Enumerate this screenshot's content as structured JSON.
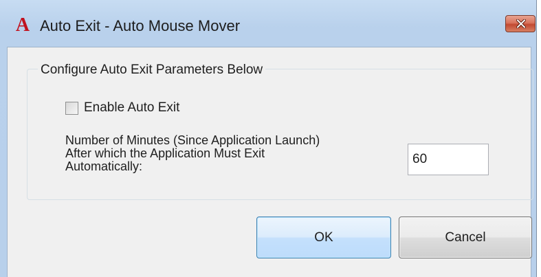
{
  "window": {
    "title": "Auto Exit - Auto Mouse Mover",
    "app_icon_glyph": "A",
    "app_icon_name": "autocad-a-icon",
    "close_icon_name": "close-icon"
  },
  "group": {
    "legend": "Configure Auto Exit Parameters Below"
  },
  "enable_auto_exit": {
    "label": "Enable Auto Exit",
    "checked": false
  },
  "minutes": {
    "description_lines": [
      "Number of Minutes (Since Application Launch)",
      "After which the Application Must Exit",
      "Automatically:"
    ],
    "value": "60"
  },
  "buttons": {
    "ok": "OK",
    "cancel": "Cancel"
  },
  "colors": {
    "title_bar": "#c0d7f0",
    "close_button": "#c9553d",
    "dialog_background": "#f0f0f0",
    "ok_border": "#3c7fb1"
  }
}
